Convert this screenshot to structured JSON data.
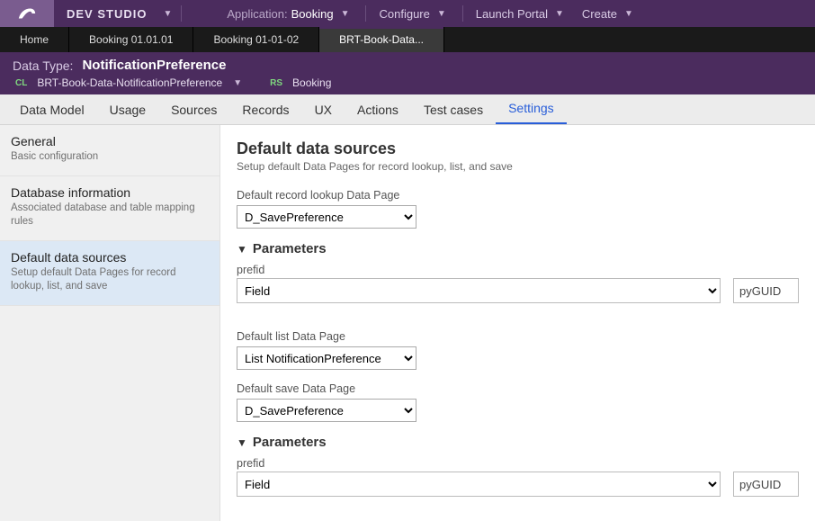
{
  "topbar": {
    "brand": "DEV STUDIO",
    "app_label": "Application:",
    "app_value": "Booking",
    "menus": {
      "configure": "Configure",
      "launch": "Launch Portal",
      "create": "Create"
    }
  },
  "tabs": {
    "items": [
      {
        "label": "Home"
      },
      {
        "label": "Booking 01.01.01"
      },
      {
        "label": "Booking 01-01-02"
      },
      {
        "label": "BRT-Book-Data..."
      }
    ]
  },
  "ruleheader": {
    "type_label": "Data Type:",
    "type_value": "NotificationPreference",
    "cl_badge": "CL",
    "class_path": "BRT-Book-Data-NotificationPreference",
    "rs_badge": "RS",
    "ruleset": "Booking"
  },
  "subtabs": {
    "items": [
      {
        "label": "Data Model"
      },
      {
        "label": "Usage"
      },
      {
        "label": "Sources"
      },
      {
        "label": "Records"
      },
      {
        "label": "UX"
      },
      {
        "label": "Actions"
      },
      {
        "label": "Test cases"
      },
      {
        "label": "Settings"
      }
    ],
    "active_index": 7
  },
  "sidepanel": {
    "items": [
      {
        "title": "General",
        "desc": "Basic configuration"
      },
      {
        "title": "Database information",
        "desc": "Associated database and table mapping rules"
      },
      {
        "title": "Default data sources",
        "desc": "Setup default Data Pages for record lookup, list, and save"
      }
    ],
    "selected_index": 2
  },
  "main": {
    "heading": "Default data sources",
    "subheading": "Setup default Data Pages for record lookup, list, and save",
    "lookup_label": "Default record lookup Data Page",
    "lookup_value": "D_SavePreference",
    "params_label": "Parameters",
    "param1_name": "prefid",
    "param1_type": "Field",
    "param1_value": "pyGUID",
    "list_label": "Default list Data Page",
    "list_value": "List NotificationPreference",
    "save_label": "Default save Data Page",
    "save_value": "D_SavePreference",
    "param2_name": "prefid",
    "param2_type": "Field",
    "param2_value": "pyGUID"
  }
}
